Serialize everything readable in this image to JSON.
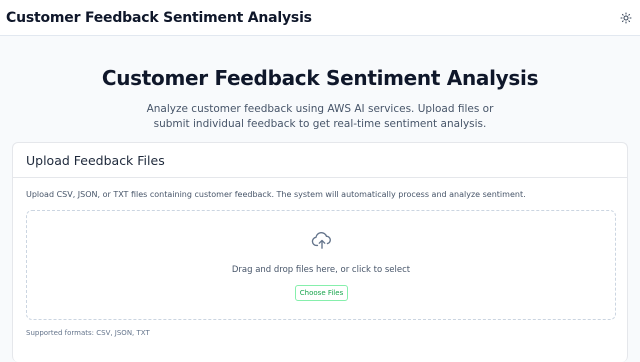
{
  "app": {
    "brand": "Customer Feedback Sentiment Analysis",
    "theme_icon": "sun-icon"
  },
  "hero": {
    "title": "Customer Feedback Sentiment Analysis",
    "subtitle": "Analyze customer feedback using AWS AI services. Upload files or submit individual feedback to get real-time sentiment analysis."
  },
  "upload_card": {
    "title": "Upload Feedback Files",
    "description": "Upload CSV, JSON, or TXT files containing customer feedback. The system will automatically process and analyze sentiment.",
    "dropzone_text": "Drag and drop files here, or click to select",
    "dropzone_icon": "cloud-upload-icon",
    "choose_button": "Choose Files",
    "supported_formats": "Supported formats: CSV, JSON, TXT"
  },
  "colors": {
    "accent": "#16a34a",
    "accent_border": "#86efac",
    "background": "#f8fafc"
  }
}
